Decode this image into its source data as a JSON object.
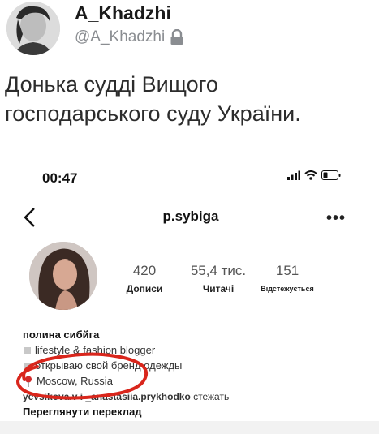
{
  "tweet": {
    "display_name": "A_Khadzhi",
    "handle": "@A_Khadzhi",
    "text": "Донька судді Вищого господарського суду України."
  },
  "phone": {
    "status_time": "00:47",
    "profile": {
      "username": "p.sybiga",
      "stats": [
        {
          "value": "420",
          "label": "Дописи"
        },
        {
          "value": "55,4 тис.",
          "label": "Читачі"
        },
        {
          "value": "151",
          "label": "Відстежується"
        }
      ],
      "bio_name": "полина сибйга",
      "bio_lines": [
        "lifestyle & fashion blogger",
        "открываю свой бренд одежды",
        "Moscow, Russia"
      ],
      "followed_by_users": "yevsikova.v i _anastasiia.prykhodko",
      "followed_by_suffix": "стежать",
      "translate_label": "Переглянути переклад"
    }
  },
  "colors": {
    "annotation": "#d9261c",
    "handle_gray": "#8a8d91"
  }
}
